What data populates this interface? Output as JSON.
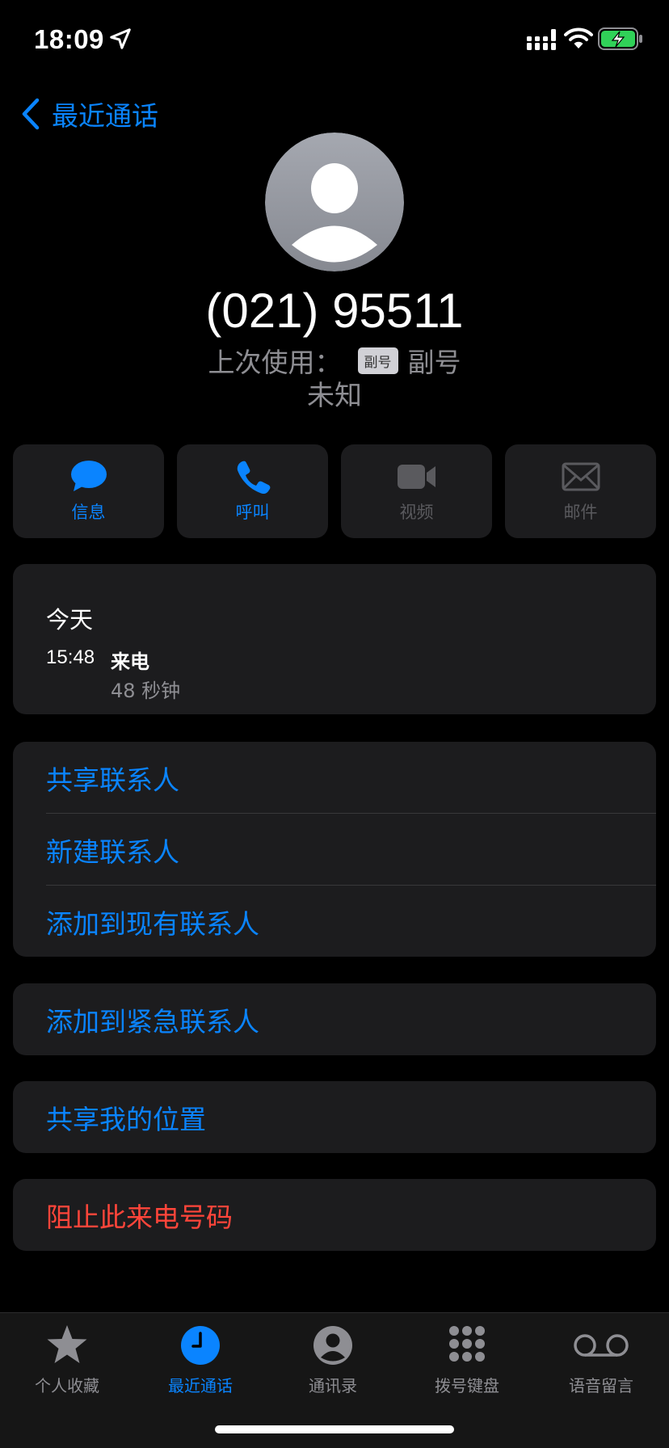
{
  "status_bar": {
    "time": "18:09"
  },
  "nav": {
    "back_label": "最近通话"
  },
  "contact": {
    "phone_number": "(021) 95511",
    "last_used_prefix": "上次使用：",
    "line_badge": "副号",
    "line_name": "副号",
    "location": "未知"
  },
  "actions": [
    {
      "label": "信息",
      "icon": "message-icon",
      "enabled": true
    },
    {
      "label": "呼叫",
      "icon": "phone-icon",
      "enabled": true
    },
    {
      "label": "视频",
      "icon": "video-icon",
      "enabled": false
    },
    {
      "label": "邮件",
      "icon": "mail-icon",
      "enabled": false
    }
  ],
  "history": {
    "date": "今天",
    "time": "15:48",
    "type": "来电",
    "duration": "48 秒钟"
  },
  "contact_options": [
    {
      "label": "共享联系人"
    },
    {
      "label": "新建联系人"
    },
    {
      "label": "添加到现有联系人"
    }
  ],
  "emergency_label": "添加到紧急联系人",
  "share_location_label": "共享我的位置",
  "block_label": "阻止此来电号码",
  "tabbar": [
    {
      "label": "个人收藏",
      "icon": "star-icon",
      "active": false
    },
    {
      "label": "最近通话",
      "icon": "clock-icon",
      "active": true
    },
    {
      "label": "通讯录",
      "icon": "person-circle-icon",
      "active": false
    },
    {
      "label": "拨号键盘",
      "icon": "keypad-icon",
      "active": false
    },
    {
      "label": "语音留言",
      "icon": "voicemail-icon",
      "active": false
    }
  ],
  "colors": {
    "accent": "#0a84ff",
    "danger": "#ff453a",
    "card": "#1c1c1e",
    "secondary_text": "#8e8e93"
  }
}
